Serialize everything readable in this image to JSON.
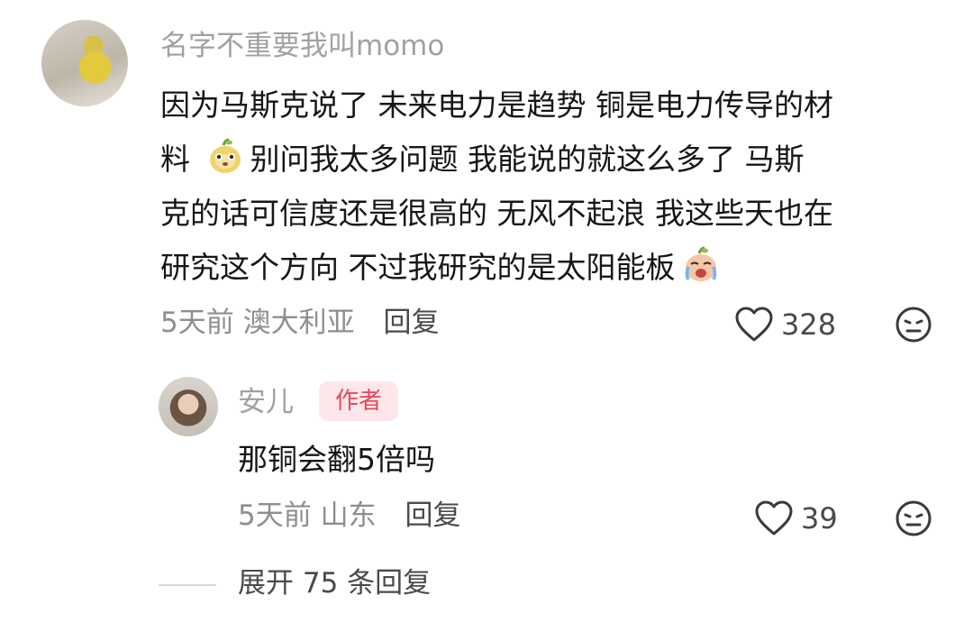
{
  "main_comment": {
    "username": "名字不重要我叫momo",
    "text_lines": [
      [
        "因为马斯克说了 未来电力是趋势 铜是电力传导的材"
      ],
      [
        "料 ",
        "别问我太多问题 我能说的就这么多了 马斯"
      ],
      [
        "克的话可信度还是很高的 无风不起浪 我这些天也在"
      ],
      [
        "研究这个方向 不过我研究的是太阳能板"
      ]
    ],
    "emojis": [
      "pear-smile-emoji",
      "pear-cry-emoji"
    ],
    "meta": {
      "time": "5天前",
      "location": "澳大利亚",
      "reply_label": "回复"
    },
    "likes": "328"
  },
  "reply_comment": {
    "username": "安儿",
    "badge": "作者",
    "text": "那铜会翻5倍吗",
    "meta": {
      "time": "5天前",
      "location": "山东",
      "reply_label": "回复"
    },
    "likes": "39"
  },
  "expand": {
    "label": "展开 75 条回复"
  },
  "colors": {
    "username": "#a1a1a1",
    "text": "#161616",
    "meta": "#8e8e8e",
    "badge_bg": "#fde7ea",
    "badge_text": "#e8465a"
  }
}
